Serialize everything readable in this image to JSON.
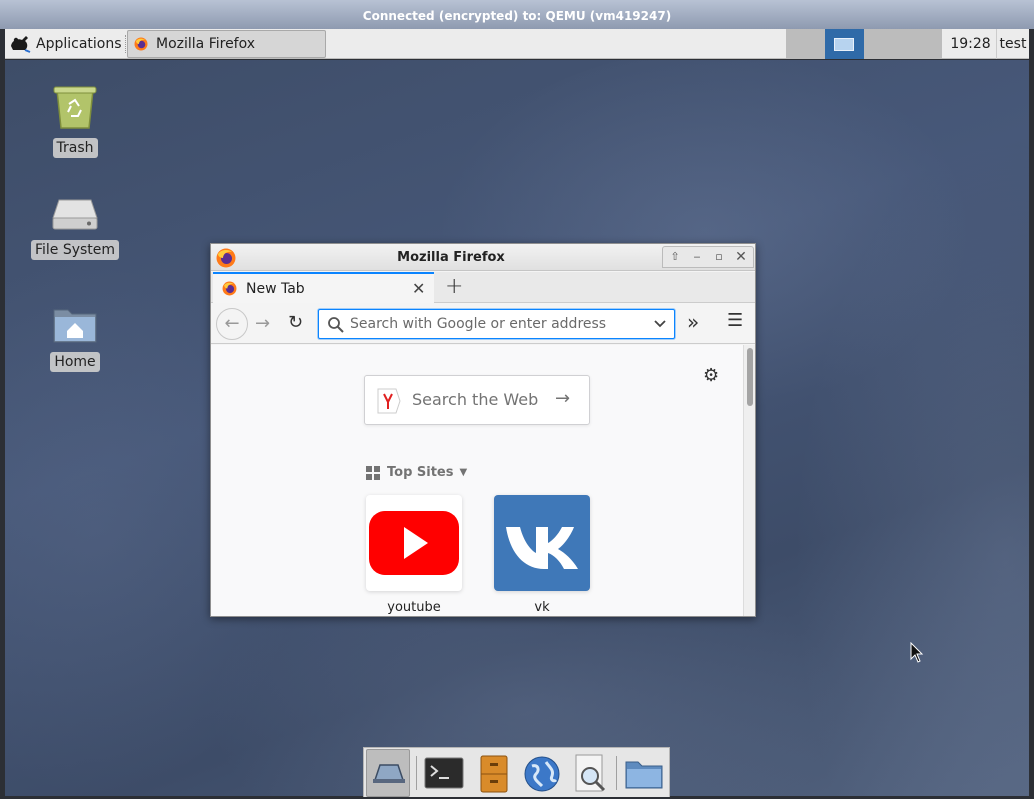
{
  "vnc": {
    "title": "Connected (encrypted) to: QEMU (vm419247)"
  },
  "panel": {
    "applications_label": "Applications",
    "task_label": "Mozilla Firefox",
    "clock": "19:28",
    "user": "test"
  },
  "desktop": {
    "icons": [
      {
        "label": "Trash"
      },
      {
        "label": "File System"
      },
      {
        "label": "Home"
      }
    ]
  },
  "firefox": {
    "window_title": "Mozilla Firefox",
    "tab_label": "New Tab",
    "url_placeholder": "Search with Google or enter address",
    "search_web_placeholder": "Search the Web",
    "top_sites_label": "Top Sites",
    "top_sites": [
      {
        "label": "youtube",
        "color": "#ff0000"
      },
      {
        "label": "vk",
        "color": "#3f78b8"
      }
    ]
  },
  "dock": {
    "items": [
      "show-desktop-icon",
      "terminal-icon",
      "file-manager-icon",
      "web-browser-icon",
      "app-finder-icon",
      "folder-icon"
    ]
  },
  "colors": {
    "accent": "#0a84ff",
    "panel_active": "#2f6aa8"
  }
}
